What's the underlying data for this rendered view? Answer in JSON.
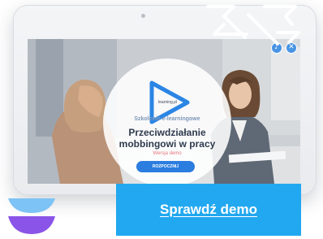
{
  "player": {
    "logo_text": "learning.pl",
    "subtitle": "Szkolenie e-learningowe",
    "course_title_line1": "Przeciwdziałanie",
    "course_title_line2": "mobbingowi w pracy",
    "version_label": "Wersja demo",
    "start_label": "ROZPOCZNIJ",
    "sound_icon": "speaker-icon",
    "close_icon": "close-icon",
    "play_icon": "play-icon"
  },
  "cta": {
    "label": "Sprawdź demo"
  },
  "colors": {
    "accent": "#22a8f0",
    "play_blue": "#2b85e4",
    "version_pink": "#e9767f",
    "icon_purple": "#8a54e8",
    "icon_lightblue": "#7ec3f5"
  }
}
